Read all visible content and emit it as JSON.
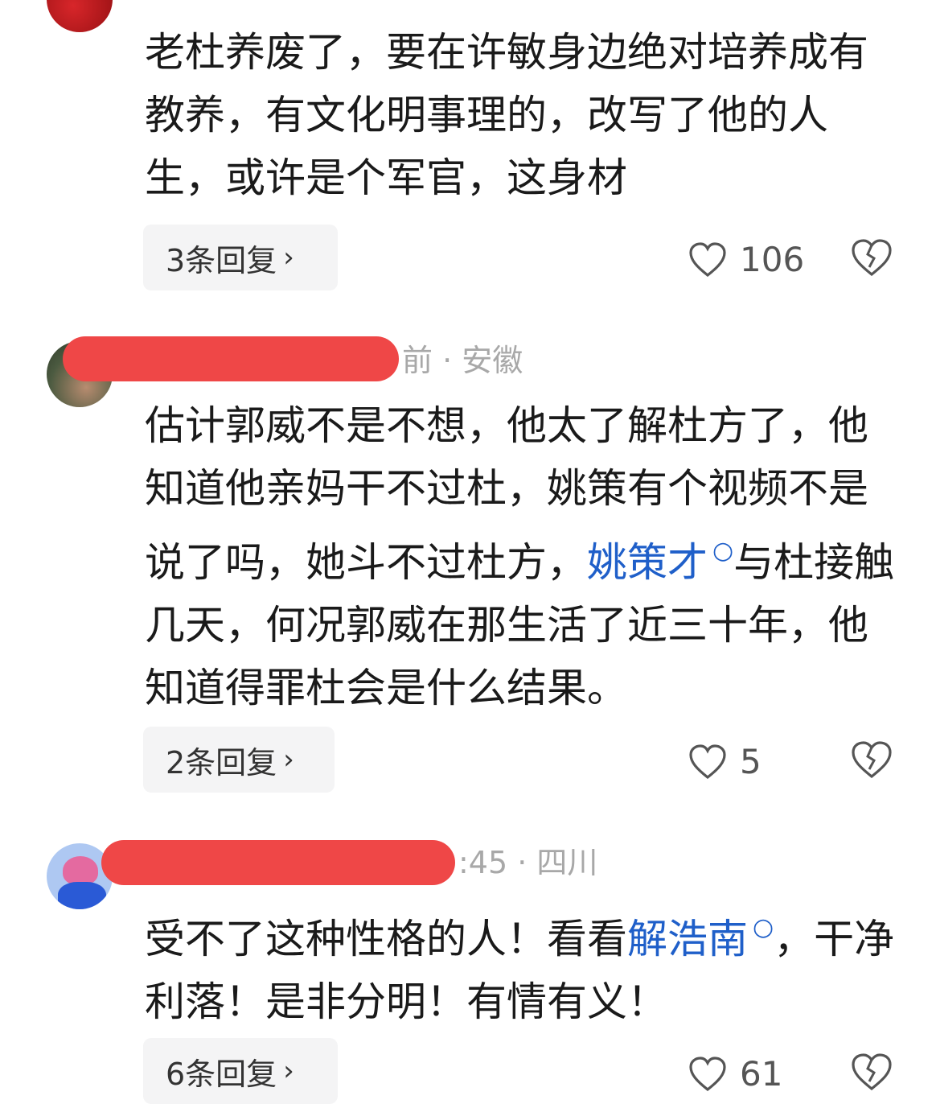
{
  "comments": [
    {
      "meta": "",
      "text": "老杜养废了，要在许敏身边绝对培养成有教养，有文化明事理的，改写了他的人生，或许是个军官，这身材",
      "replies": "3条回复",
      "likes": "106"
    },
    {
      "meta": "前 · 安徽",
      "text_before": "估计郭威不是不想，他太了解杜方了，他知道他亲妈干不过杜，姚策有个视频不是说了吗，她斗不过杜方，",
      "link": "姚策才",
      "text_after": "与杜接触几天，何况郭威在那生活了近三十年，他知道得罪杜会是什么结果。",
      "replies": "2条回复",
      "likes": "5"
    },
    {
      "meta": ":45 · 四川",
      "text_before": "受不了这种性格的人！看看",
      "link": "解浩南",
      "text_after": "，干净利落！是非分明！有情有义！",
      "replies": "6条回复",
      "likes": "61"
    }
  ],
  "icons": {
    "like": "heart-outline-icon",
    "dislike": "broken-heart-icon",
    "search": "search-icon",
    "chevron": "chevron-right-icon"
  },
  "colors": {
    "link": "#1f5fc9",
    "redaction": "#ef4747",
    "reply_bg": "#f4f4f5"
  }
}
